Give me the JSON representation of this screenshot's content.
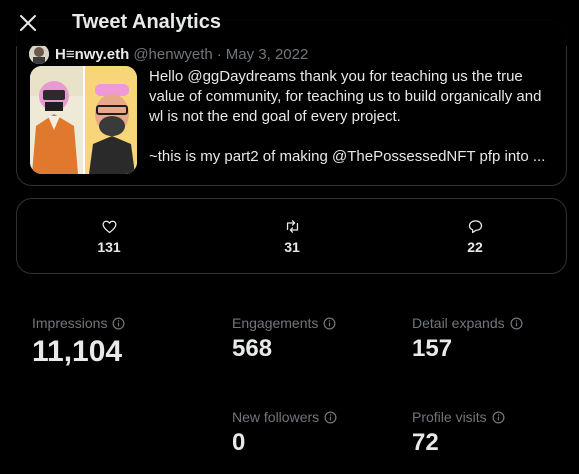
{
  "header": {
    "title": "Tweet Analytics"
  },
  "tweet": {
    "author_name": "H≡nwy.eth",
    "author_handle": "@henwyeth",
    "separator": "·",
    "date": "May 3, 2022",
    "paragraphs": [
      "Hello @ggDaydreams thank you for teaching us the true value of community, for teaching us to build organically and wl is not the end goal of every project.",
      "~this is my part2 of making @ThePossessedNFT pfp into ..."
    ]
  },
  "actions": [
    {
      "icon": "heart-icon",
      "count": "131"
    },
    {
      "icon": "retweet-icon",
      "count": "31"
    },
    {
      "icon": "reply-icon",
      "count": "22"
    }
  ],
  "metrics": {
    "impressions": {
      "label": "Impressions",
      "value": "11,104"
    },
    "engagements": {
      "label": "Engagements",
      "value": "568"
    },
    "detail_expands": {
      "label": "Detail expands",
      "value": "157"
    },
    "new_followers": {
      "label": "New followers",
      "value": "0"
    },
    "profile_visits": {
      "label": "Profile visits",
      "value": "72"
    }
  },
  "colors": {
    "background": "#000000",
    "border": "#2f3336",
    "text_primary": "#e7e9ea",
    "text_secondary": "#71767b"
  }
}
